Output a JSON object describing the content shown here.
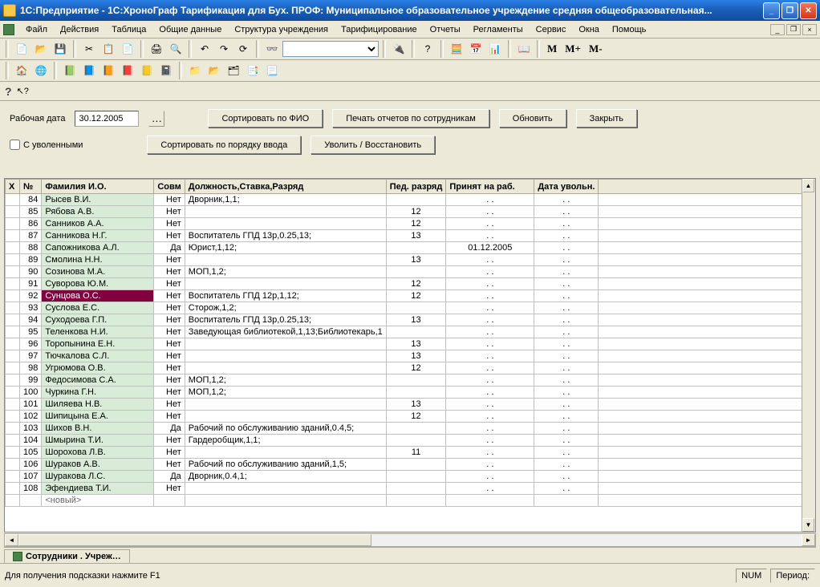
{
  "window": {
    "title": "1С:Предприятие - 1С:ХроноГраф Тарификация для Бух. ПРОФ: Муниципальное образовательное учреждение средняя общеобразовательная..."
  },
  "menu": [
    "Файл",
    "Действия",
    "Таблица",
    "Общие данные",
    "Структура учреждения",
    "Тарифицирование",
    "Отчеты",
    "Регламенты",
    "Сервис",
    "Окна",
    "Помощь"
  ],
  "mbtns": [
    "M",
    "M+",
    "M-"
  ],
  "controls": {
    "date_label": "Рабочая дата",
    "date_value": "30.12.2005",
    "sort_fio": "Сортировать по ФИО",
    "print": "Печать отчетов по сотрудникам",
    "refresh": "Обновить",
    "close": "Закрыть",
    "fired": "С уволенными",
    "sort_order": "Сортировать по порядку ввода",
    "fire_restore": "Уволить / Восстановить"
  },
  "headers": {
    "x": "X",
    "n": "№",
    "f": "Фамилия И.О.",
    "s": "Совм",
    "d": "Должность,Ставка,Разряд",
    "p": "Пед. разряд",
    "h": "Принят на раб.",
    "u": "Дата увольн."
  },
  "rows": [
    {
      "n": "84",
      "f": "Рысев В.И.",
      "s": "Нет",
      "d": "Дворник,1,1;",
      "p": "",
      "h": ".  .",
      "u": ".  ."
    },
    {
      "n": "85",
      "f": "Рябова А.В.",
      "s": "Нет",
      "d": "",
      "p": "12",
      "h": ".  .",
      "u": ".  ."
    },
    {
      "n": "86",
      "f": "Санников А.А.",
      "s": "Нет",
      "d": "",
      "p": "12",
      "h": ".  .",
      "u": ".  ."
    },
    {
      "n": "87",
      "f": "Санникова Н.Г.",
      "s": "Нет",
      "d": "Воспитатель ГПД 13р,0.25,13;",
      "p": "13",
      "h": ".  .",
      "u": ".  ."
    },
    {
      "n": "88",
      "f": "Сапожникова А.Л.",
      "s": "Да",
      "d": "Юрист,1,12;",
      "p": "",
      "h": "01.12.2005",
      "u": ".  ."
    },
    {
      "n": "89",
      "f": "Смолина Н.Н.",
      "s": "Нет",
      "d": "",
      "p": "13",
      "h": ".  .",
      "u": ".  ."
    },
    {
      "n": "90",
      "f": "Созинова М.А.",
      "s": "Нет",
      "d": "МОП,1,2;",
      "p": "",
      "h": ".  .",
      "u": ".  ."
    },
    {
      "n": "91",
      "f": "Суворова Ю.М.",
      "s": "Нет",
      "d": "",
      "p": "12",
      "h": ".  .",
      "u": ".  ."
    },
    {
      "n": "92",
      "f": "Сунцова О.С.",
      "s": "Нет",
      "d": "Воспитатель ГПД 12р,1,12;",
      "p": "12",
      "h": ".  .",
      "u": ".  .",
      "sel": true
    },
    {
      "n": "93",
      "f": "Суслова Е.С.",
      "s": "Нет",
      "d": "Сторож,1,2;",
      "p": "",
      "h": ".  .",
      "u": ".  ."
    },
    {
      "n": "94",
      "f": "Суходоева Г.П.",
      "s": "Нет",
      "d": "Воспитатель ГПД 13р,0.25,13;",
      "p": "13",
      "h": ".  .",
      "u": ".  ."
    },
    {
      "n": "95",
      "f": "Теленкова Н.И.",
      "s": "Нет",
      "d": "Заведующая библиотекой,1,13;Библиотекарь,1",
      "p": "",
      "h": ".  .",
      "u": ".  ."
    },
    {
      "n": "96",
      "f": "Торопынина Е.Н.",
      "s": "Нет",
      "d": "",
      "p": "13",
      "h": ".  .",
      "u": ".  ."
    },
    {
      "n": "97",
      "f": "Тючкалова С.Л.",
      "s": "Нет",
      "d": "",
      "p": "13",
      "h": ".  .",
      "u": ".  ."
    },
    {
      "n": "98",
      "f": "Угрюмова О.В.",
      "s": "Нет",
      "d": "",
      "p": "12",
      "h": ".  .",
      "u": ".  ."
    },
    {
      "n": "99",
      "f": "Федосимова С.А.",
      "s": "Нет",
      "d": "МОП,1,2;",
      "p": "",
      "h": ".  .",
      "u": ".  ."
    },
    {
      "n": "100",
      "f": "Чуркина Г.Н.",
      "s": "Нет",
      "d": "МОП,1,2;",
      "p": "",
      "h": ".  .",
      "u": ".  ."
    },
    {
      "n": "101",
      "f": "Шиляева Н.В.",
      "s": "Нет",
      "d": "",
      "p": "13",
      "h": ".  .",
      "u": ".  ."
    },
    {
      "n": "102",
      "f": "Шипицына Е.А.",
      "s": "Нет",
      "d": "",
      "p": "12",
      "h": ".  .",
      "u": ".  ."
    },
    {
      "n": "103",
      "f": "Шихов В.Н.",
      "s": "Да",
      "d": "Рабочий по обслуживанию зданий,0.4,5;",
      "p": "",
      "h": ".  .",
      "u": ".  ."
    },
    {
      "n": "104",
      "f": "Шмырина Т.И.",
      "s": "Нет",
      "d": "Гардеробщик,1,1;",
      "p": "",
      "h": ".  .",
      "u": ".  ."
    },
    {
      "n": "105",
      "f": "Шорохова Л.В.",
      "s": "Нет",
      "d": "",
      "p": "11",
      "h": ".  .",
      "u": ".  ."
    },
    {
      "n": "106",
      "f": "Шураков А.В.",
      "s": "Нет",
      "d": "Рабочий по обслуживанию зданий,1,5;",
      "p": "",
      "h": ".  .",
      "u": ".  ."
    },
    {
      "n": "107",
      "f": "Шуракова Л.С.",
      "s": "Да",
      "d": "Дворник,0.4,1;",
      "p": "",
      "h": ".  .",
      "u": ".  ."
    },
    {
      "n": "108",
      "f": "Эфендиева Т.И.",
      "s": "Нет",
      "d": "",
      "p": "",
      "h": ".  .",
      "u": ".  ."
    }
  ],
  "new_label": "<новый>",
  "tab": "Сотрудники . Учреж…",
  "statusbar": {
    "hint": "Для получения подсказки нажмите F1",
    "num": "NUM",
    "period": "Период:"
  }
}
